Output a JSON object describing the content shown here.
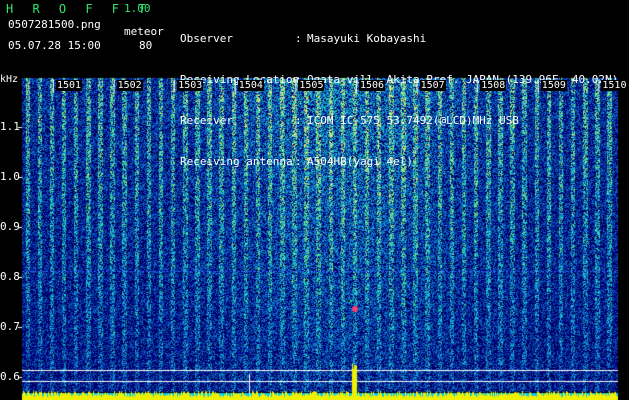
{
  "header": {
    "app_title": "H R O F F T",
    "version": "1.00",
    "filename": "0507281500.png",
    "meteor_label": "meteor",
    "datetime": "05.07.28 15:00",
    "meteor_count": "80"
  },
  "info": [
    {
      "key": "Observer",
      "value": "Masayuki Kobayashi"
    },
    {
      "key": "Receiving Location",
      "value": "Ogata-vill. Akita-Pref. JAPAN (139.96E, 40.02N)"
    },
    {
      "key": "Receiver",
      "value": "ICOM IC-575 53.7492(@LCD)MHz USB"
    },
    {
      "key": "Receiving antenna",
      "value": "A504HB(yagi 4el)"
    }
  ],
  "axis": {
    "unit": "kHz",
    "y_ticks": [
      "1.1",
      "1.0",
      "0.9",
      "0.8",
      "0.7",
      "0.6"
    ],
    "x_ticks": [
      "1501",
      "1502",
      "1503",
      "1504",
      "1505",
      "1506",
      "1507",
      "1508",
      "1509",
      "1510"
    ]
  },
  "colors": {
    "background": "#000000",
    "title": "#2ee66e",
    "spectrum_low": "#00008c",
    "spectrum_mid": "#1e64c8",
    "spectrum_high": "#3ce6a0",
    "signal_bar": "#f0f000",
    "meteor_mark": "#ff3c78"
  }
}
